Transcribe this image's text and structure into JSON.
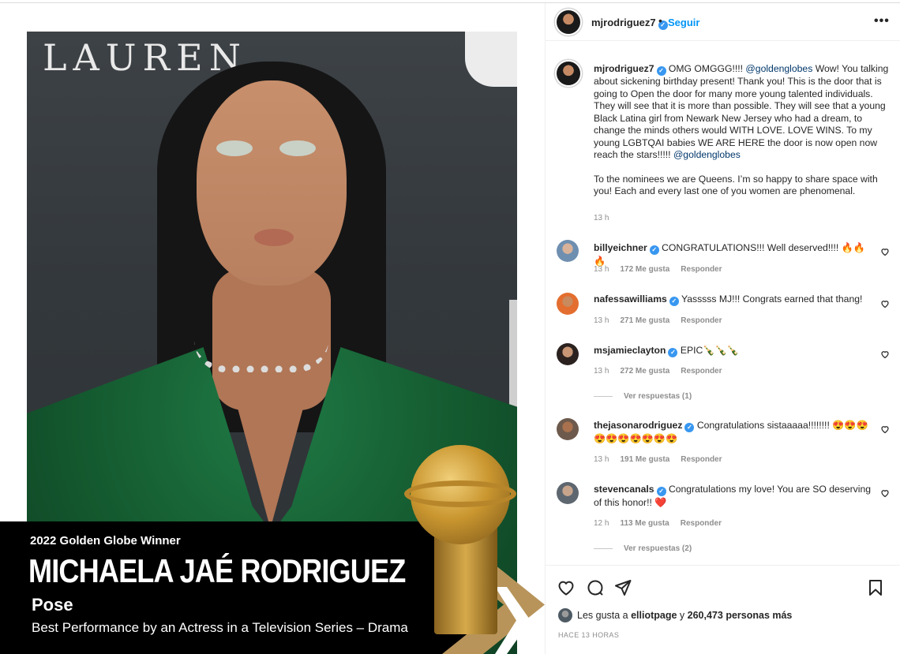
{
  "media": {
    "backdrop_text": "LAUREN",
    "banner_kicker": "2022 Golden Globe Winner",
    "banner_name": "MICHAELA JAÉ RODRIGUEZ",
    "banner_show": "Pose",
    "banner_category": "Best Performance by an Actress in a Television Series – Drama"
  },
  "header": {
    "username": "mjrodriguez7",
    "separator": "•",
    "follow_label": "Seguir",
    "more_label": "•••"
  },
  "caption": {
    "username": "mjrodriguez7",
    "text_1": "OMG OMGGG!!!! ",
    "mention_1": "@goldenglobes",
    "text_2": " Wow! You talking about sickening birthday present! Thank you! This is the door that is going to Open the door for many more young talented individuals. They will see that it is more than possible. They will see that a young Black Latina girl from Newark New Jersey who had a dream, to change the minds others would WITH LOVE. LOVE WINS. To my young LGBTQAI babies WE ARE HERE the door is now open now reach the stars!!!!! ",
    "mention_2": "@goldenglobes",
    "paragraph_2": "To the nominees we are Queens. I’m so happy to share space with you! Each and every last one of you women are phenomenal.",
    "time": "13 h"
  },
  "comments": [
    {
      "username": "billyeichner",
      "text": "CONGRATULATIONS!!! Well deserved!!!! 🔥🔥🔥",
      "time": "13 h",
      "likes": "172 Me gusta",
      "reply": "Responder"
    },
    {
      "username": "nafessawilliams",
      "text": "Yasssss MJ!!! Congrats earned that thang!",
      "time": "13 h",
      "likes": "271 Me gusta",
      "reply": "Responder"
    },
    {
      "username": "msjamieclayton",
      "text": "EPIC🍾🍾🍾",
      "time": "13 h",
      "likes": "272 Me gusta",
      "reply": "Responder",
      "view_replies": "Ver respuestas (1)"
    },
    {
      "username": "thejasonarodriguez",
      "text": "Congratulations sistaaaaa!!!!!!!! 😍😍😍😍😍😍😍😍😍😍",
      "time": "13 h",
      "likes": "191 Me gusta",
      "reply": "Responder"
    },
    {
      "username": "stevencanals",
      "text": "Congratulations my love! You are SO deserving of this honor!! ❤️",
      "time": "12 h",
      "likes": "113 Me gusta",
      "reply": "Responder",
      "view_replies": "Ver respuestas (2)"
    }
  ],
  "footer": {
    "likes_prefix": "Les gusta a ",
    "likes_user": "elliotpage",
    "likes_middle": " y ",
    "likes_count": "260,473 personas más",
    "time_ago": "HACE 13 HORAS"
  },
  "icons": {
    "verified": "verified-badge-icon",
    "like": "heart-icon",
    "comment": "comment-icon",
    "share": "paper-plane-icon",
    "save": "bookmark-icon"
  },
  "colors": {
    "link": "#0095f6",
    "mention": "#00376b",
    "verified": "#3897f0",
    "muted": "#8e8e8e",
    "heart_red": "#ed4956"
  }
}
